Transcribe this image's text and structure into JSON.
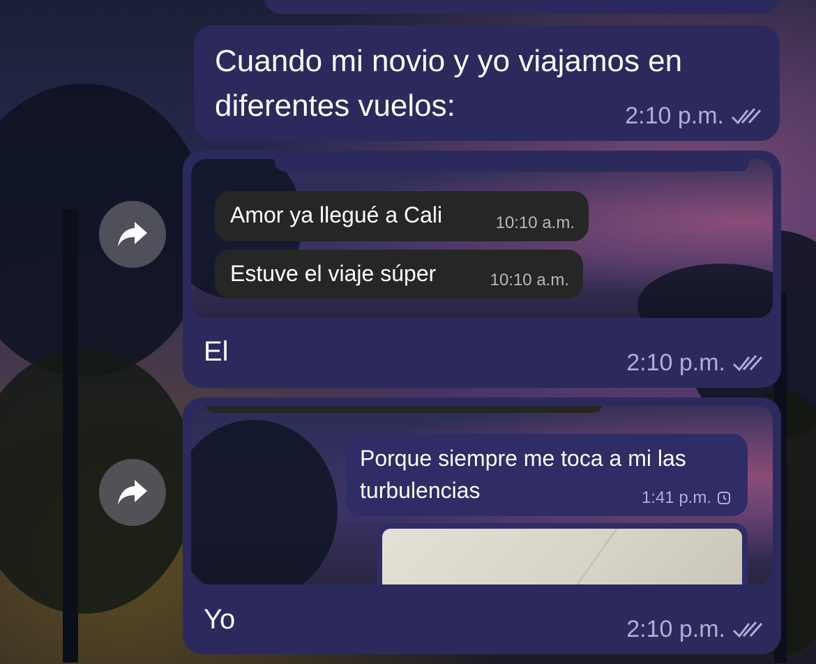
{
  "messages": [
    {
      "text": "Cuando mi novio y yo viajamos en diferentes vuelos:",
      "time": "2:10 p.m."
    },
    {
      "caption": "El",
      "time": "2:10 p.m.",
      "screenshot": {
        "messages": [
          {
            "text": "Amor ya llegué a Cali",
            "time": "10:10 a.m."
          },
          {
            "text": "Estuve el viaje súper",
            "time": "10:10 a.m."
          }
        ]
      }
    },
    {
      "caption": "Yo",
      "time": "2:10 p.m.",
      "screenshot": {
        "message": {
          "text": "Porque siempre me toca a mi las turbulencias",
          "time": "1:41 p.m."
        }
      }
    }
  ],
  "icons": {
    "forward": "forward-icon",
    "read_receipt": "double-check-icon",
    "pending": "clock-icon"
  },
  "colors": {
    "bubble": "#2c2a5c",
    "timestamp": "#aeb0d6",
    "dark_bubble": "#262626"
  }
}
